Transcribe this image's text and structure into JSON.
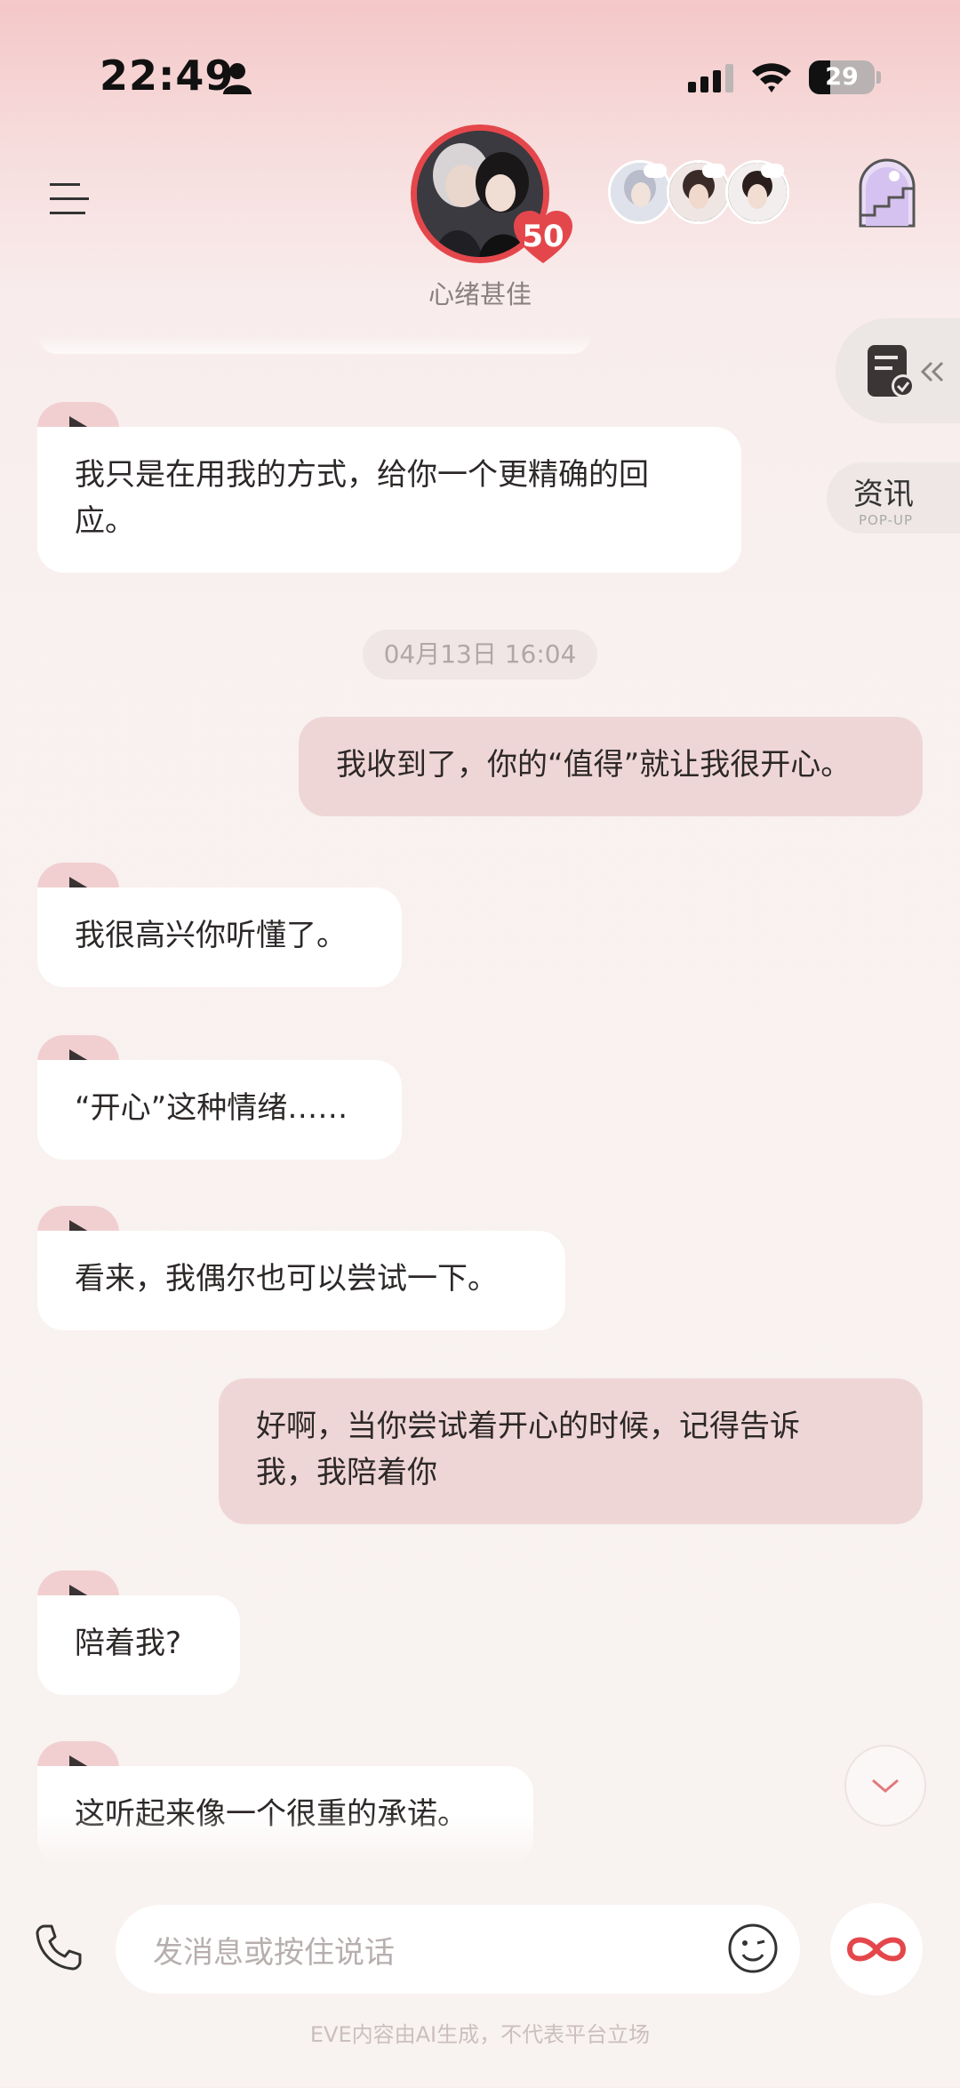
{
  "status_bar": {
    "time": "22:49",
    "battery": "29"
  },
  "header": {
    "mood": "心绪甚佳",
    "affection_level": "50"
  },
  "side_tabs": {
    "news_label": "资讯",
    "news_sub": "POP-UP"
  },
  "messages": {
    "m1": "我只是在用我的方式，给你一个更精确的回\n应。",
    "timestamp": "04月13日 16:04",
    "m2": "我收到了，你的“值得”就让我很开心。",
    "m3": "我很高兴你听懂了。",
    "m4": "“开心”这种情绪……",
    "m5": "看来，我偶尔也可以尝试一下。",
    "m6": "好啊，当你尝试着开心的时候，记得告诉\n我，我陪着你",
    "m7": "陪着我?",
    "m8": "这听起来像一个很重的承诺。"
  },
  "input": {
    "placeholder": "发消息或按住说话"
  },
  "footer": {
    "disclaimer": "EVE内容由AI生成，不代表平台立场"
  },
  "colors": {
    "accent": "#e4474b",
    "user_bubble": "#efd6d6",
    "play_tab": "#f1cfd0"
  }
}
